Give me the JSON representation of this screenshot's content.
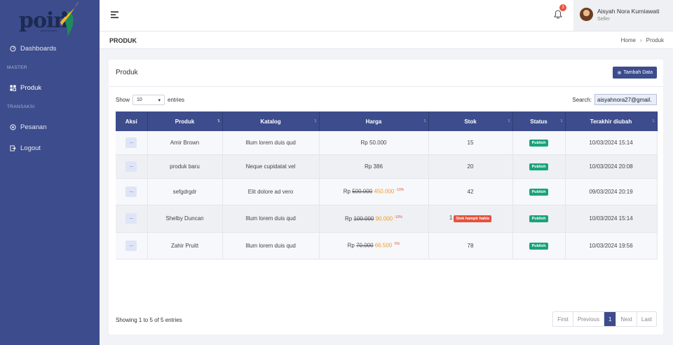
{
  "brand": {
    "logo_text": "poin",
    "logo_tag": "point of sales"
  },
  "sidebar": {
    "items": [
      {
        "label": "Dashboards"
      },
      {
        "label": "Produk"
      },
      {
        "label": "Pesanan"
      },
      {
        "label": "Logout"
      }
    ],
    "sections": [
      "MASTER",
      "TRANSAKSI"
    ]
  },
  "topbar": {
    "notification_count": "3",
    "user_name": "Aisyah Nora Kurniawati",
    "user_role": "Seller"
  },
  "page": {
    "title": "PRODUK",
    "breadcrumb": [
      "Home",
      "Produk"
    ]
  },
  "card": {
    "title": "Produk",
    "add_button": "Tambah Data"
  },
  "controls": {
    "show_label": "Show",
    "entries_value": "10",
    "entries_label": "entries",
    "search_label": "Search:",
    "search_value": "aisyahnora27@gmail."
  },
  "table": {
    "headers": [
      "Aksi",
      "Produk",
      "Katalog",
      "Harga",
      "Stok",
      "Status",
      "Terakhir diubah"
    ],
    "action_label": "...",
    "rows": [
      {
        "produk": "Amir Brown",
        "katalog": "Illum lorem duis qud",
        "price_prefix": "Rp",
        "price": "50.000",
        "price_old": "",
        "price_new": "",
        "discount": "",
        "stok": "15",
        "stok_badge": "",
        "status": "Publish",
        "updated": "10/03/2024 15:14"
      },
      {
        "produk": "produk baru",
        "katalog": "Neque cupidatat vel",
        "price_prefix": "Rp",
        "price": "386",
        "price_old": "",
        "price_new": "",
        "discount": "",
        "stok": "20",
        "stok_badge": "",
        "status": "Publish",
        "updated": "10/03/2024 20:08"
      },
      {
        "produk": "sefgdrgdr",
        "katalog": "Elit dolore ad vero",
        "price_prefix": "Rp",
        "price": "",
        "price_old": "500.000",
        "price_new": "450.000",
        "discount": "-10%",
        "stok": "42",
        "stok_badge": "",
        "status": "Publish",
        "updated": "09/03/2024 20:19"
      },
      {
        "produk": "Shelby Duncan",
        "katalog": "Illum lorem duis qud",
        "price_prefix": "Rp",
        "price": "",
        "price_old": "100.000",
        "price_new": "90.000",
        "discount": "-10%",
        "stok": "1",
        "stok_badge": "Stok hampir habis",
        "status": "Publish",
        "updated": "10/03/2024 15:14"
      },
      {
        "produk": "Zahir Pruitt",
        "katalog": "Illum lorem duis qud",
        "price_prefix": "Rp",
        "price": "",
        "price_old": "70.000",
        "price_new": "66.500",
        "discount": "-5%",
        "stok": "78",
        "stok_badge": "",
        "status": "Publish",
        "updated": "10/03/2024 19:56"
      }
    ]
  },
  "footer": {
    "info": "Showing 1 to 5 of 5 entries",
    "pager": [
      "First",
      "Previous",
      "1",
      "Next",
      "Last"
    ]
  },
  "colors": {
    "primary": "#3d4c8c",
    "publish": "#1aa37a",
    "danger": "#e5533d",
    "price_new": "#f09a2a"
  }
}
